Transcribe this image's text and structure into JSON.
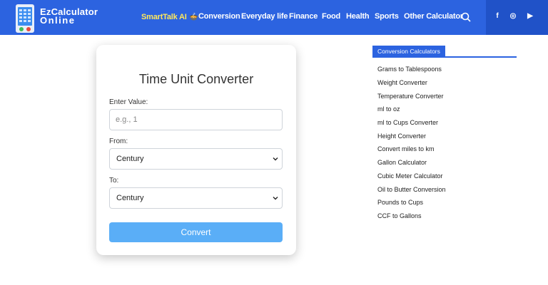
{
  "brand": {
    "line1": "EzCalculator",
    "line2": "Online"
  },
  "nav": {
    "items": [
      "SmartTalk AI",
      "Conversion",
      "Everyday life",
      "Finance",
      "Food",
      "Health",
      "Sports",
      "Other Calculator"
    ],
    "smart_emoji": "🍲"
  },
  "social": [
    "f",
    "◎",
    "▶"
  ],
  "converter": {
    "title": "Time Unit Converter",
    "value_label": "Enter Value:",
    "value_placeholder": "e.g., 1",
    "from_label": "From:",
    "from_value": "Century",
    "to_label": "To:",
    "to_value": "Century",
    "button": "Convert"
  },
  "sidebar": {
    "heading": "Conversion Calculators",
    "items": [
      "Grams to Tablespoons",
      "Weight Converter",
      "Temperature Converter",
      "ml to oz",
      "ml to Cups Converter",
      "Height Converter",
      "Convert miles to km",
      "Gallon Calculator",
      "Cubic Meter Calculator",
      "Oil to Butter Conversion",
      "Pounds to Cups",
      "CCF to Gallons"
    ]
  },
  "colors": {
    "header": "#2c63e0",
    "social_bg": "#2052c8",
    "smarttalk": "#ffe85c",
    "button": "#5aaef7"
  }
}
